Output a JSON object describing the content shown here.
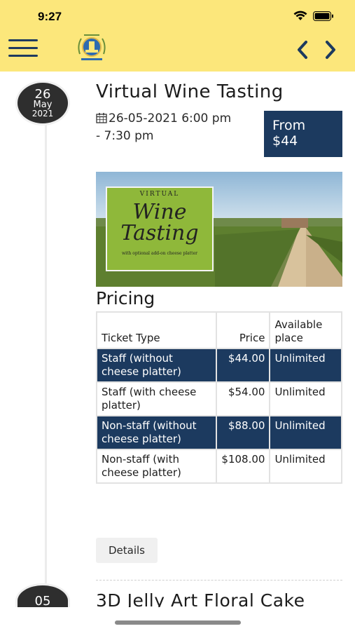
{
  "status_bar": {
    "time": "9:27"
  },
  "header": {
    "menu_icon": "hamburger-menu-icon",
    "logo_icon": "organization-crest-logo",
    "prev_icon": "chevron-left-icon",
    "next_icon": "chevron-right-icon"
  },
  "events": [
    {
      "date": {
        "day": "26",
        "month": "May",
        "year": "2021"
      },
      "title": "Virtual Wine Tasting",
      "datetime_line1": "26-05-2021  6:00 pm",
      "datetime_line2": "- 7:30 pm",
      "price_line1": "From",
      "price_line2": "$44",
      "banner": {
        "top": "VIRTUAL",
        "main1": "Wine",
        "main2": "Tasting",
        "sub": "with optional add-on cheese platter"
      },
      "pricing_heading": "Pricing",
      "table": {
        "headers": {
          "type": "Ticket Type",
          "price": "Price",
          "avail_1": "Available",
          "avail_2": "place"
        },
        "rows": [
          {
            "type": "Staff (without cheese platter)",
            "price": "$44.00",
            "availability": "Unlimited"
          },
          {
            "type": "Staff (with cheese platter)",
            "price": "$54.00",
            "availability": "Unlimited"
          },
          {
            "type": "Non-staff (without cheese platter)",
            "price": "$88.00",
            "availability": "Unlimited"
          },
          {
            "type": "Non-staff (with cheese platter)",
            "price": "$108.00",
            "availability": "Unlimited"
          }
        ]
      },
      "details_label": "Details"
    },
    {
      "date": {
        "day": "05"
      },
      "title": "3D Jelly Art Floral Cake"
    }
  ],
  "colors": {
    "header_bg": "#fce77b",
    "navy": "#1c3a5f",
    "badge": "#2e2e2e"
  }
}
